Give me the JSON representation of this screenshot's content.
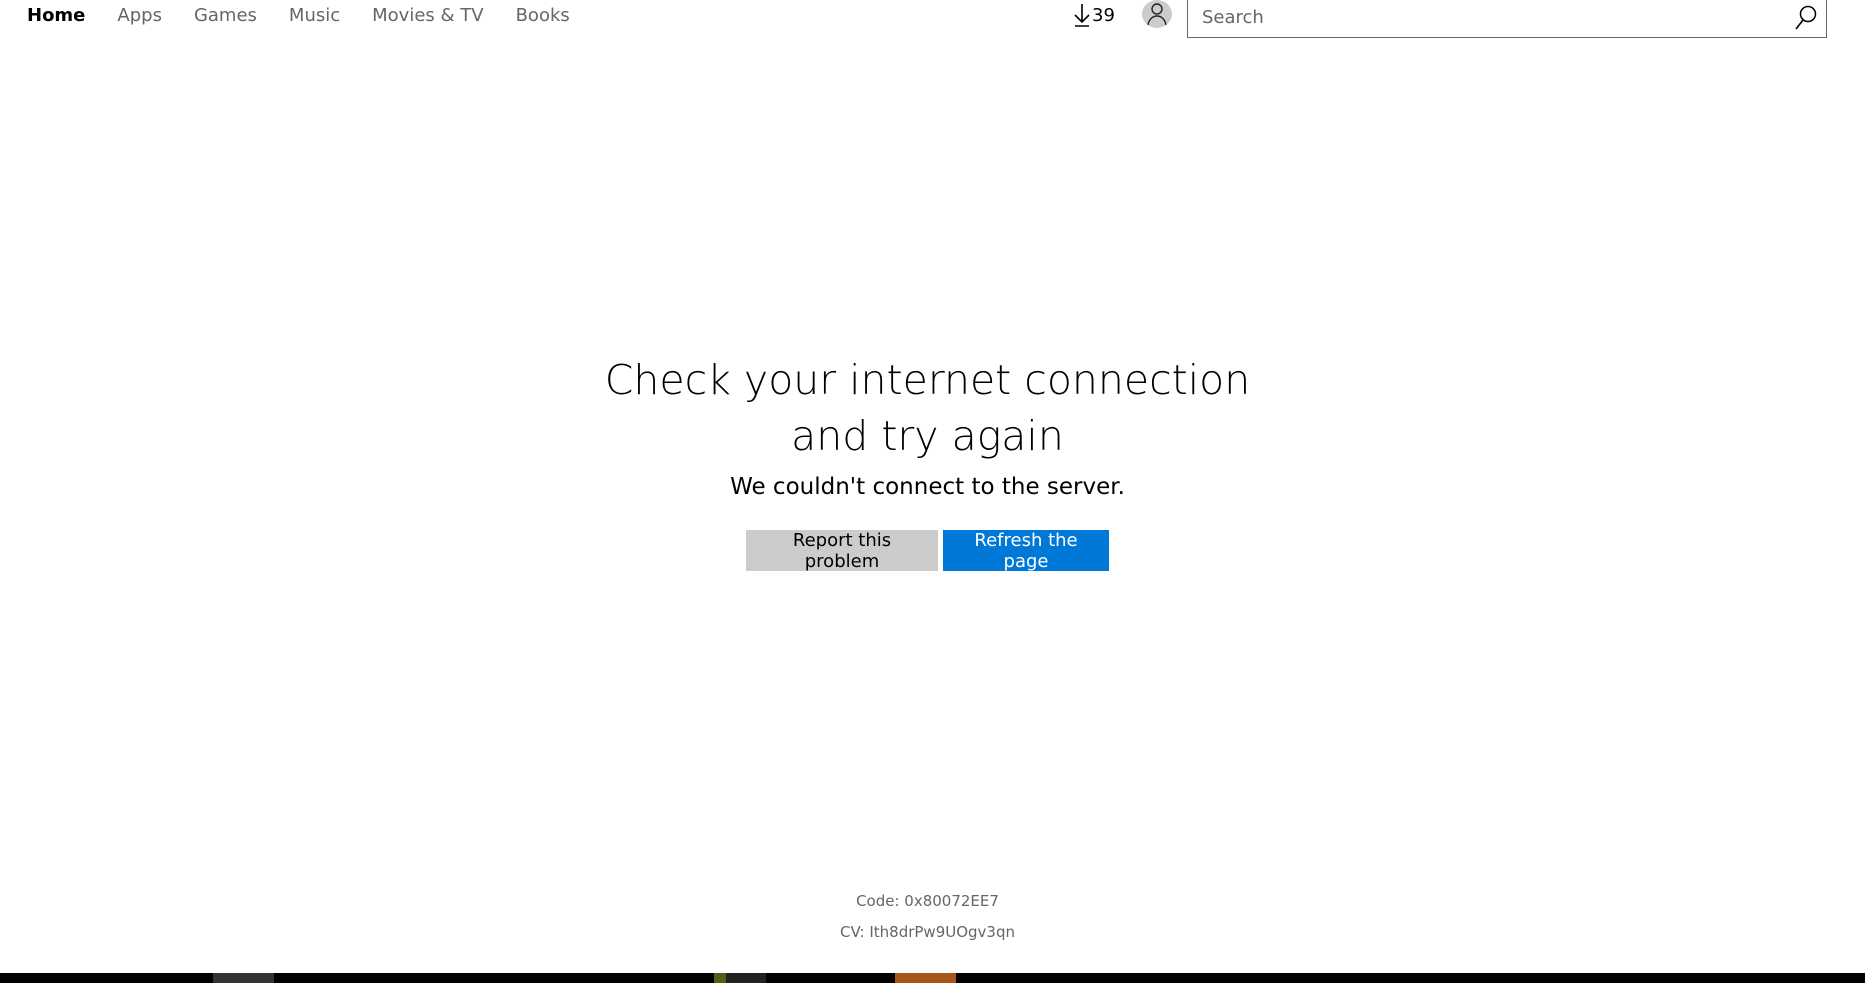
{
  "nav": {
    "items": [
      {
        "label": "Home",
        "active": true
      },
      {
        "label": "Apps"
      },
      {
        "label": "Games"
      },
      {
        "label": "Music"
      },
      {
        "label": "Movies & TV"
      },
      {
        "label": "Books"
      }
    ]
  },
  "header": {
    "downloads_count": "39",
    "download_icon": "download-arrow-icon",
    "account_icon": "person-icon",
    "search_placeholder": "Search",
    "search_value": "",
    "search_icon": "search-icon"
  },
  "error": {
    "title_line1": "Check your internet connection",
    "title_line2": "and try again",
    "subtitle": "We couldn't connect to the server.",
    "report_label": "Report this problem",
    "refresh_label": "Refresh the page",
    "code": "Code: 0x80072EE7",
    "cv": "CV: Ith8drPw9UOgv3qn"
  },
  "colors": {
    "accent": "#0078d7",
    "secondary_button": "#cccccc"
  }
}
